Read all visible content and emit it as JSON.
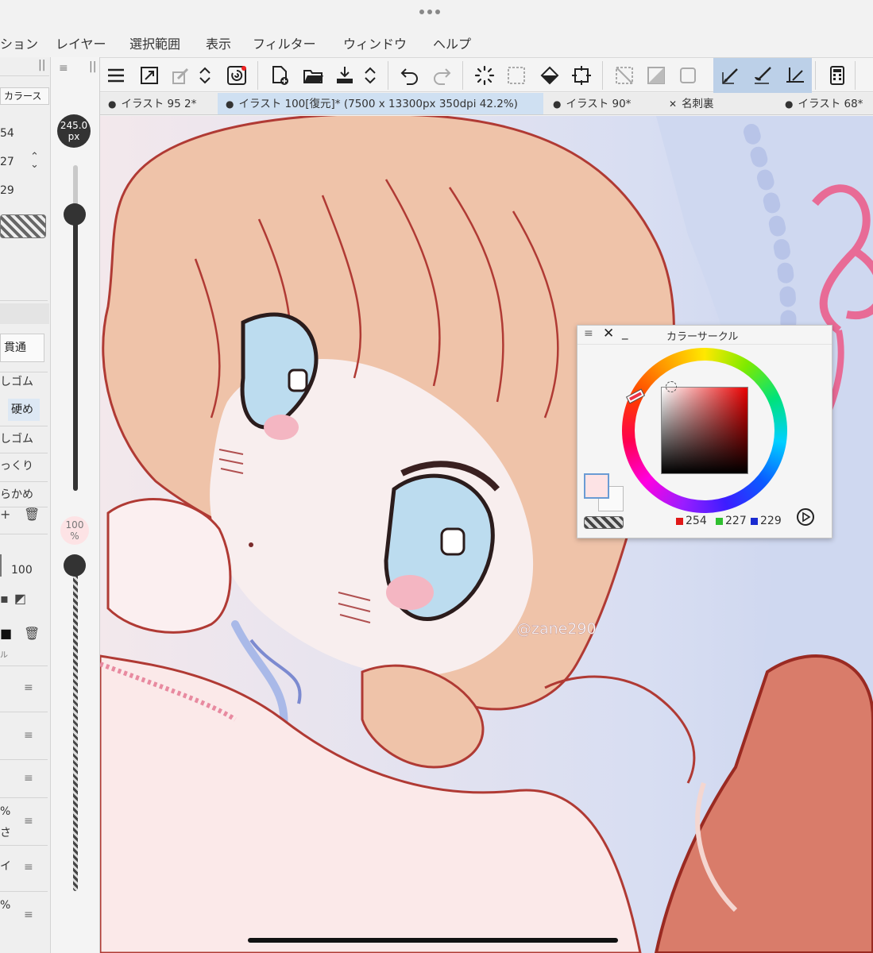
{
  "menu": [
    "ション",
    "レイヤー",
    "選択範囲",
    "表示",
    "フィルター",
    "ウィンドウ",
    "ヘルプ"
  ],
  "tabs": [
    {
      "label": "イラスト 95 2*",
      "prefix": "●",
      "active": false
    },
    {
      "label": "イラスト 100[復元]* (7500 x 13300px 350dpi 42.2%)",
      "prefix": "●",
      "active": true
    },
    {
      "label": "イラスト 90*",
      "prefix": "●",
      "active": false
    },
    {
      "label": "名刺裏",
      "prefix": "✕",
      "active": false
    },
    {
      "label": "イラスト 68*",
      "prefix": "●",
      "active": false
    }
  ],
  "left_panel": {
    "tab_label": "カラース",
    "values": [
      "54",
      "27",
      "29"
    ],
    "brush_items": [
      "貫通",
      "しゴム",
      "硬め",
      "しゴム",
      "っくり",
      "らかめ"
    ],
    "opacity_value": "100",
    "percent_rows": [
      "%",
      "さ",
      "イ",
      "%"
    ],
    "small_label": "ル"
  },
  "size": {
    "value": "245.0",
    "unit": "px",
    "opacity_value": "100",
    "opacity_unit": "%",
    "size_level": 0.85,
    "opacity_level": 1.0
  },
  "canvas": {
    "watermark": "@zane290"
  },
  "color_circle": {
    "title": "カラーサークル",
    "r": "254",
    "g": "227",
    "b": "229",
    "main_color": "#fde3e5",
    "sub_color": "#fafafa",
    "hue_color": "#e80000"
  },
  "colors": {
    "accent": "#bcd0e8",
    "tab_active": "#cfe0f2"
  }
}
